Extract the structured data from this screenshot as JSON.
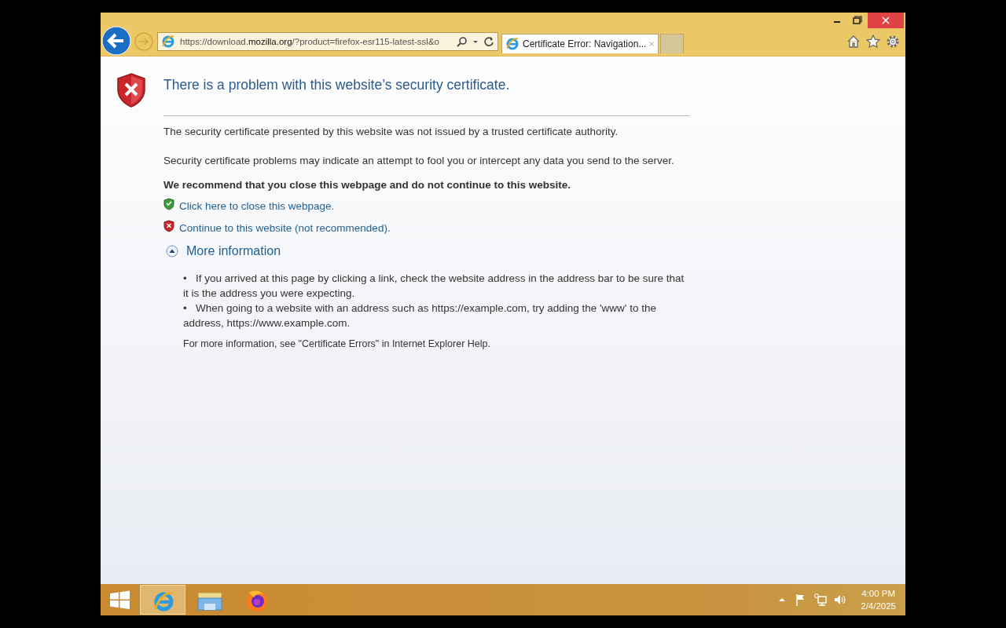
{
  "browser": {
    "address": "https://download.**mozilla.org**/?product=firefox-esr115-latest-ssl&o",
    "tabs": [
      {
        "title": "Certificate Error: Navigation...",
        "selected": true
      }
    ]
  },
  "page": {
    "heading": "There is a problem with this website’s security certificate.",
    "paragraphs": [
      "The security certificate presented by this website was not issued by a trusted certificate authority.",
      "Security certificate problems may indicate an attempt to fool you or intercept any data you send to the server."
    ],
    "recommendation": "We recommend that you close this webpage and do not continue to this website.",
    "links": [
      {
        "kind": "safe",
        "text": "Click here to close this webpage."
      },
      {
        "kind": "unsafe",
        "text": "Continue to this website (not recommended)."
      }
    ],
    "more_info": {
      "label": "More information",
      "expanded": true,
      "bullets": [
        "•   If you arrived at this page by clicking a link, check the website address in the address bar to be sure that it is the address you were expecting.",
        "•   When going to a website with an address such as https://example.com, try adding the 'www' to the address, https://www.example.com."
      ],
      "footer": "For more information, see \"Certificate Errors\" in Internet Explorer Help."
    }
  },
  "taskbar": {
    "apps": [
      {
        "kind": "ie",
        "selected": true
      },
      {
        "kind": "explorer",
        "selected": false
      },
      {
        "kind": "firefox",
        "selected": false
      }
    ],
    "time": "4:00 PM",
    "date": "2/4/2025"
  }
}
